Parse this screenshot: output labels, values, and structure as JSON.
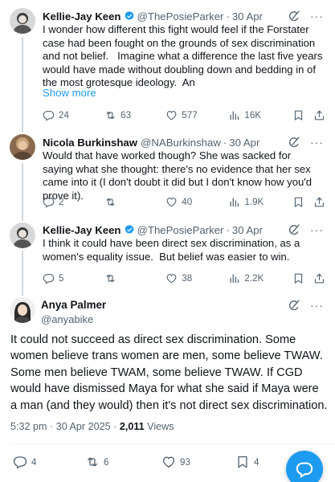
{
  "replies": [
    {
      "name": "Kellie-Jay Keen",
      "verified": true,
      "handle": "@ThePosieParker",
      "dot": "·",
      "time": "30 Apr",
      "text": "I wonder how different this fight would feel if the Forstater case had been fought on the grounds of sex discrimination and not belief.   Imagine what a difference the last five years would have made without doubling down and bedding in of the most grotesque ideology.  An",
      "show_more": "Show more",
      "counts": {
        "replies": "24",
        "reposts": "63",
        "likes": "577",
        "views": "16K"
      }
    },
    {
      "name": "Nicola Burkinshaw",
      "verified": false,
      "handle": "@NABurkinshaw",
      "dot": "·",
      "time": "30 Apr",
      "text": "Would that have worked though? She was sacked for saying what she thought: there's no evidence that her sex came into it (I don't doubt it did but I don't know how you'd prove it).",
      "counts": {
        "replies": "2",
        "reposts": "",
        "likes": "40",
        "views": "1.9K"
      }
    },
    {
      "name": "Kellie-Jay Keen",
      "verified": true,
      "handle": "@ThePosieParker",
      "dot": "·",
      "time": "30 Apr",
      "text": "I think it could have been direct sex discrimination, as a women's equality issue.  But belief was easier to win.",
      "counts": {
        "replies": "5",
        "reposts": "",
        "likes": "38",
        "views": "2.2K"
      }
    }
  ],
  "main": {
    "name": "Anya Palmer",
    "handle": "@anyabike",
    "text": "It could not succeed as direct sex discrimination. Some women believe trans women are men, some believe TWAW. Some men believe TWAM, some believe TWAW. If CGD would have dismissed Maya for what she said if Maya were a man (and they would) then it's not direct sex discrimination.",
    "time": "5:32 pm · 30 Apr 2025 · ",
    "views_count": "2,011",
    "views_label": " Views",
    "counts": {
      "replies": "4",
      "reposts": "6",
      "likes": "93",
      "bookmarks": "4"
    }
  },
  "icons": {
    "more": "more-icon",
    "grok": "grok-icon",
    "verified": "verified-badge-icon",
    "reply": "reply-icon",
    "repost": "repost-icon",
    "like": "like-icon",
    "views": "views-icon",
    "bookmark": "bookmark-icon",
    "share": "share-icon",
    "compose": "compose-reply-icon"
  },
  "colors": {
    "accent": "#1d9bf0",
    "muted": "#536471",
    "text": "#0f1419",
    "line": "#cfd9de"
  },
  "more_label": "···"
}
